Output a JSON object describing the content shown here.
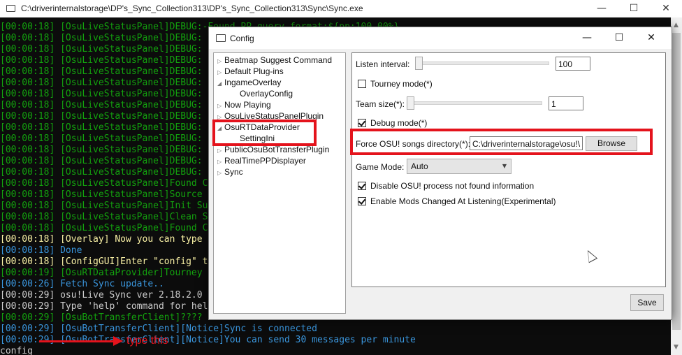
{
  "console": {
    "title": "C:\\driverinternalstorage\\DP's_Sync_Collection313\\DP's_Sync_Collection313\\Sync\\Sync.exe",
    "lines": [
      {
        "text": "[00:00:18] [OsuLiveStatusPanel]DEBUG:-Found PP query format:${pp:100.00%}",
        "color": "#13a10e"
      },
      {
        "text": "[00:00:18] [OsuLiveStatusPanel]DEBUG:",
        "color": "#13a10e"
      },
      {
        "text": "[00:00:18] [OsuLiveStatusPanel]DEBUG:",
        "color": "#13a10e"
      },
      {
        "text": "[00:00:18] [OsuLiveStatusPanel]DEBUG:",
        "color": "#13a10e"
      },
      {
        "text": "[00:00:18] [OsuLiveStatusPanel]DEBUG:",
        "color": "#13a10e"
      },
      {
        "text": "[00:00:18] [OsuLiveStatusPanel]DEBUG:",
        "color": "#13a10e"
      },
      {
        "text": "[00:00:18] [OsuLiveStatusPanel]DEBUG:",
        "color": "#13a10e"
      },
      {
        "text": "[00:00:18] [OsuLiveStatusPanel]DEBUG:",
        "color": "#13a10e"
      },
      {
        "text": "[00:00:18] [OsuLiveStatusPanel]DEBUG:",
        "color": "#13a10e"
      },
      {
        "text": "[00:00:18] [OsuLiveStatusPanel]DEBUG:",
        "color": "#13a10e"
      },
      {
        "text": "[00:00:18] [OsuLiveStatusPanel]DEBUG:",
        "color": "#13a10e"
      },
      {
        "text": "[00:00:18] [OsuLiveStatusPanel]DEBUG:",
        "color": "#13a10e"
      },
      {
        "text": "[00:00:18] [OsuLiveStatusPanel]DEBUG:",
        "color": "#13a10e"
      },
      {
        "text": "[00:00:18] [OsuLiveStatusPanel]DEBUG:",
        "color": "#13a10e"
      },
      {
        "text": "[00:00:18] [OsuLiveStatusPanel]Found C",
        "color": "#13a10e"
      },
      {
        "text": "[00:00:18] [OsuLiveStatusPanel]Source",
        "color": "#13a10e"
      },
      {
        "text": "[00:00:18] [OsuLiveStatusPanel]Init Su",
        "color": "#13a10e"
      },
      {
        "text": "[00:00:18] [OsuLiveStatusPanel]Clean S",
        "color": "#13a10e"
      },
      {
        "text": "[00:00:18] [OsuLiveStatusPanel]Found C",
        "color": "#13a10e"
      },
      {
        "text": "[00:00:18] [Overlay] Now you can type",
        "color": "#f9f1a5"
      },
      {
        "text": "[00:00:18] Done",
        "color": "#3a96dd"
      },
      {
        "text": "[00:00:18] [ConfigGUI]Enter \"config\" t",
        "color": "#f9f1a5"
      },
      {
        "text": "[00:00:19] [OsuRTDataProvider]Tourney",
        "color": "#13a10e"
      },
      {
        "text": "[00:00:26] Fetch Sync update..",
        "color": "#3a96dd"
      },
      {
        "text": "[00:00:29] osu!Live Sync ver 2.18.2.0",
        "color": "#cccccc"
      },
      {
        "text": "[00:00:29] Type 'help' command for hel",
        "color": "#cccccc"
      },
      {
        "text": "[00:00:29] [OsuBotTransferClient]????",
        "color": "#13a10e"
      },
      {
        "text": "[00:00:29] [OsuBotTransferClient][Notice]Sync is connected",
        "color": "#3a96dd"
      },
      {
        "text": "[00:00:29] [OsuBotTransferClient][Notice]You can send 30 messages per minute",
        "color": "#3a96dd"
      },
      {
        "text": "config",
        "color": "#cccccc"
      },
      {
        "text": ">",
        "color": "#13a10e"
      }
    ],
    "annotation": "type this",
    "annotation_color": "#e4131c"
  },
  "dialog": {
    "title": "Config",
    "tree": [
      {
        "label": "Beatmap Suggest Command",
        "level": 0,
        "expander": "▷"
      },
      {
        "label": "Default Plug-ins",
        "level": 0,
        "expander": "▷"
      },
      {
        "label": "IngameOverlay",
        "level": 0,
        "expander": "◢"
      },
      {
        "label": "OverlayConfig",
        "level": 1,
        "expander": ""
      },
      {
        "label": "Now Playing",
        "level": 0,
        "expander": "▷"
      },
      {
        "label": "OsuLiveStatusPanelPlugin",
        "level": 0,
        "expander": "▷"
      },
      {
        "label": "OsuRTDataProvider",
        "level": 0,
        "expander": "◢"
      },
      {
        "label": "SettingIni",
        "level": 1,
        "expander": ""
      },
      {
        "label": "PublicOsuBotTransferPlugin",
        "level": 0,
        "expander": "▷"
      },
      {
        "label": "RealTimePPDisplayer",
        "level": 0,
        "expander": "▷"
      },
      {
        "label": "Sync",
        "level": 0,
        "expander": "▷"
      }
    ],
    "settings": {
      "listen_interval_label": "Listen interval:",
      "listen_interval_value": "100",
      "tourney_mode_label": "Tourney mode(*)",
      "tourney_mode_checked": false,
      "team_size_label": "Team size(*):",
      "team_size_value": "1",
      "debug_mode_label": "Debug mode(*)",
      "debug_mode_checked": true,
      "songs_dir_label": "Force OSU! songs directory(*):",
      "songs_dir_value": "C:\\driverinternalstorage\\osu!\\",
      "browse_label": "Browse",
      "game_mode_label": "Game Mode:",
      "game_mode_value": "Auto",
      "disable_notfound_label": "Disable OSU! process not found information",
      "disable_notfound_checked": true,
      "mods_changed_label": "Enable Mods Changed At Listening(Experimental)",
      "mods_changed_checked": true
    },
    "save_label": "Save"
  },
  "colors": {
    "console_bg": "#0c0c0c",
    "highlight": "#e4131c"
  }
}
